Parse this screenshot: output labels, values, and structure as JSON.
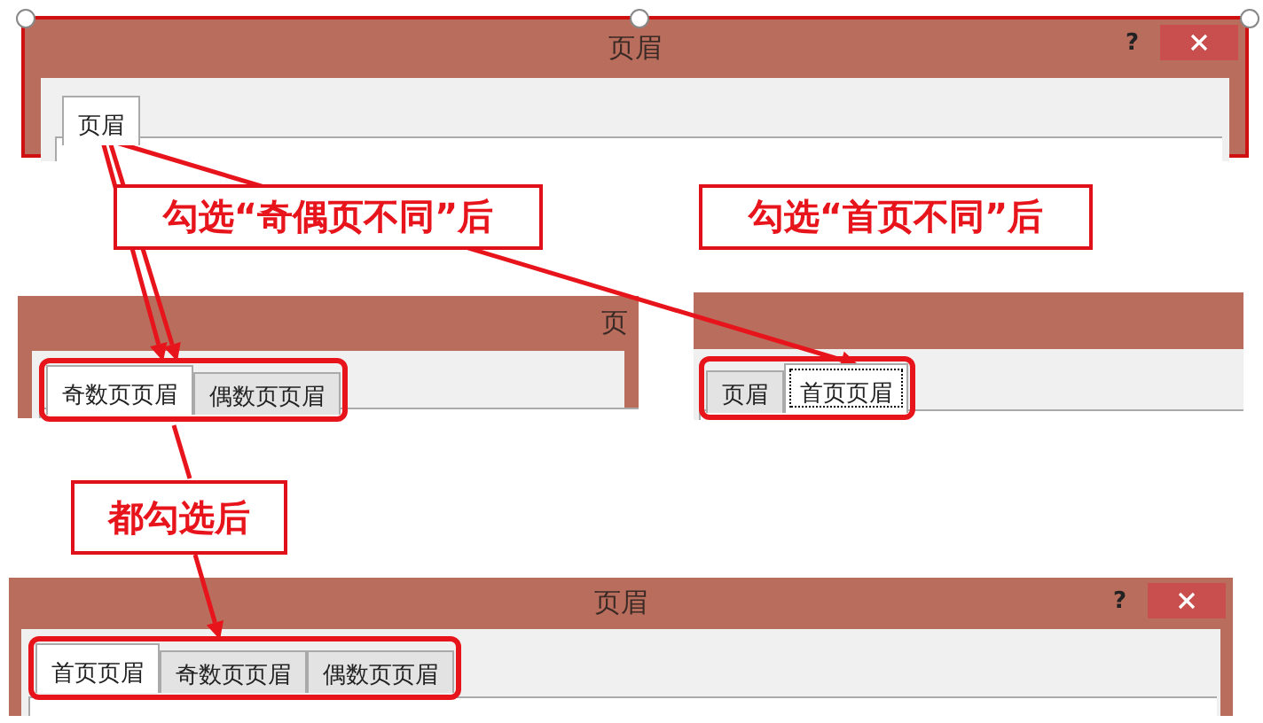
{
  "dialogs": [
    {
      "title": "页眉",
      "help": "?",
      "close_button": true,
      "highlighted": false,
      "tabs": [
        {
          "label": "页眉",
          "selected": true,
          "focused": false
        }
      ]
    },
    {
      "title": "页",
      "close_button": false,
      "highlighted": true,
      "tabs": [
        {
          "label": "奇数页页眉",
          "selected": true,
          "focused": false
        },
        {
          "label": "偶数页页眉",
          "selected": false,
          "focused": false
        }
      ]
    },
    {
      "close_button": false,
      "highlighted": true,
      "tabs": [
        {
          "label": "页眉",
          "selected": false,
          "focused": false
        },
        {
          "label": "首页页眉",
          "selected": true,
          "focused": true
        }
      ]
    },
    {
      "title": "页眉",
      "help": "?",
      "close_button": true,
      "highlighted": true,
      "tabs": [
        {
          "label": "首页页眉",
          "selected": true,
          "focused": false
        },
        {
          "label": "奇数页页眉",
          "selected": false,
          "focused": false
        },
        {
          "label": "偶数页页眉",
          "selected": false,
          "focused": false
        }
      ]
    }
  ],
  "callouts": [
    {
      "text": "勾选“奇偶页不同”后"
    },
    {
      "text": "勾选“首页不同”后"
    },
    {
      "text": "都勾选后"
    }
  ]
}
